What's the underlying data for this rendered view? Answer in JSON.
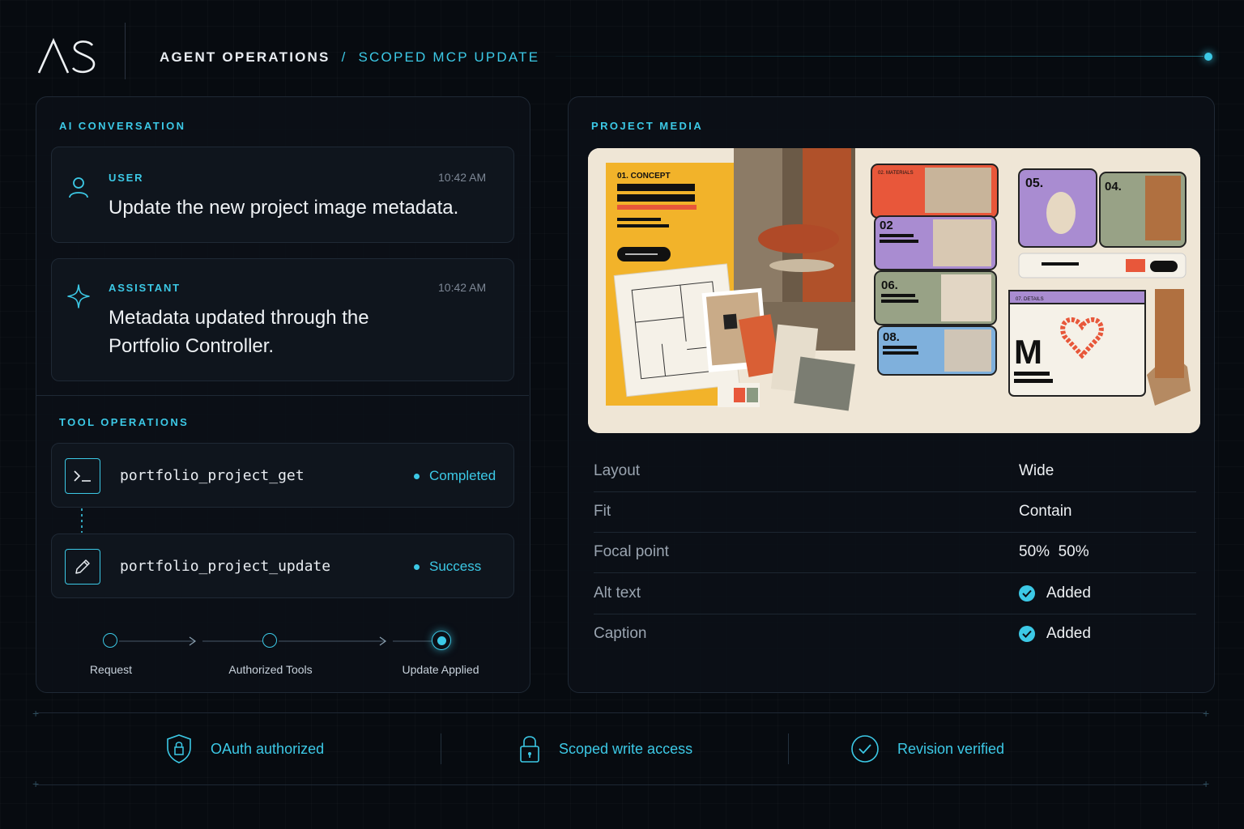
{
  "header": {
    "logo": "AS",
    "crumb_main": "AGENT OPERATIONS",
    "crumb_sep": "/",
    "crumb_sub": "SCOPED MCP UPDATE"
  },
  "conversation": {
    "title": "AI CONVERSATION",
    "messages": [
      {
        "role": "USER",
        "time": "10:42 AM",
        "text": "Update the new project image metadata.",
        "icon": "user-icon"
      },
      {
        "role": "ASSISTANT",
        "time": "10:42 AM",
        "text_line1": "Metadata updated through the",
        "text_line2": "Portfolio Controller.",
        "icon": "sparkle-icon"
      }
    ]
  },
  "tools": {
    "title": "TOOL OPERATIONS",
    "items": [
      {
        "name": "portfolio_project_get",
        "status": "Completed",
        "icon": "terminal-icon"
      },
      {
        "name": "portfolio_project_update",
        "status": "Success",
        "icon": "pencil-icon"
      }
    ]
  },
  "steps": [
    {
      "label": "Request",
      "state": "done"
    },
    {
      "label": "Authorized Tools",
      "state": "done"
    },
    {
      "label": "Update Applied",
      "state": "active"
    }
  ],
  "media": {
    "title": "PROJECT MEDIA",
    "image_labels": {
      "concept": "01. CONCEPT",
      "materials": "02. MATERIALS",
      "card02": "02",
      "card06": "06.",
      "card08": "08.",
      "card05": "05.",
      "card04": "04.",
      "details": "07. DETAILS",
      "letter": "M"
    },
    "properties": [
      {
        "key": "Layout",
        "value": "Wide",
        "check": false
      },
      {
        "key": "Fit",
        "value": "Contain",
        "check": false
      },
      {
        "key": "Focal point",
        "value": "50%  50%",
        "check": false
      },
      {
        "key": "Alt text",
        "value": "Added",
        "check": true
      },
      {
        "key": "Caption",
        "value": "Added",
        "check": true
      }
    ]
  },
  "footer": [
    {
      "label": "OAuth authorized",
      "icon": "shield-lock-icon"
    },
    {
      "label": "Scoped write access",
      "icon": "padlock-icon"
    },
    {
      "label": "Revision verified",
      "icon": "check-circle-icon"
    }
  ],
  "colors": {
    "accent": "#3cc9e6",
    "background": "#070b10",
    "panel": "#0c1118"
  }
}
